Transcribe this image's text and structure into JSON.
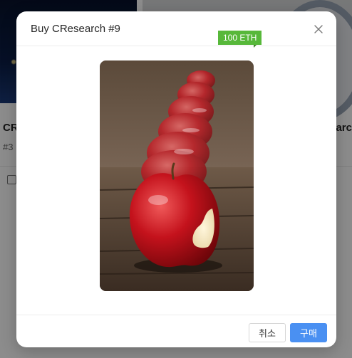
{
  "background": {
    "card_left_title": "CR",
    "card_left_sub": "#3",
    "card_right_title": "earc"
  },
  "modal": {
    "title": "Buy CResearch #9",
    "price_badge": "100 ETH",
    "cancel_label": "취소",
    "buy_label": "구매"
  },
  "colors": {
    "badge": "#57b83a",
    "primary": "#4a90f2"
  },
  "icons": {
    "close": "close-icon"
  }
}
